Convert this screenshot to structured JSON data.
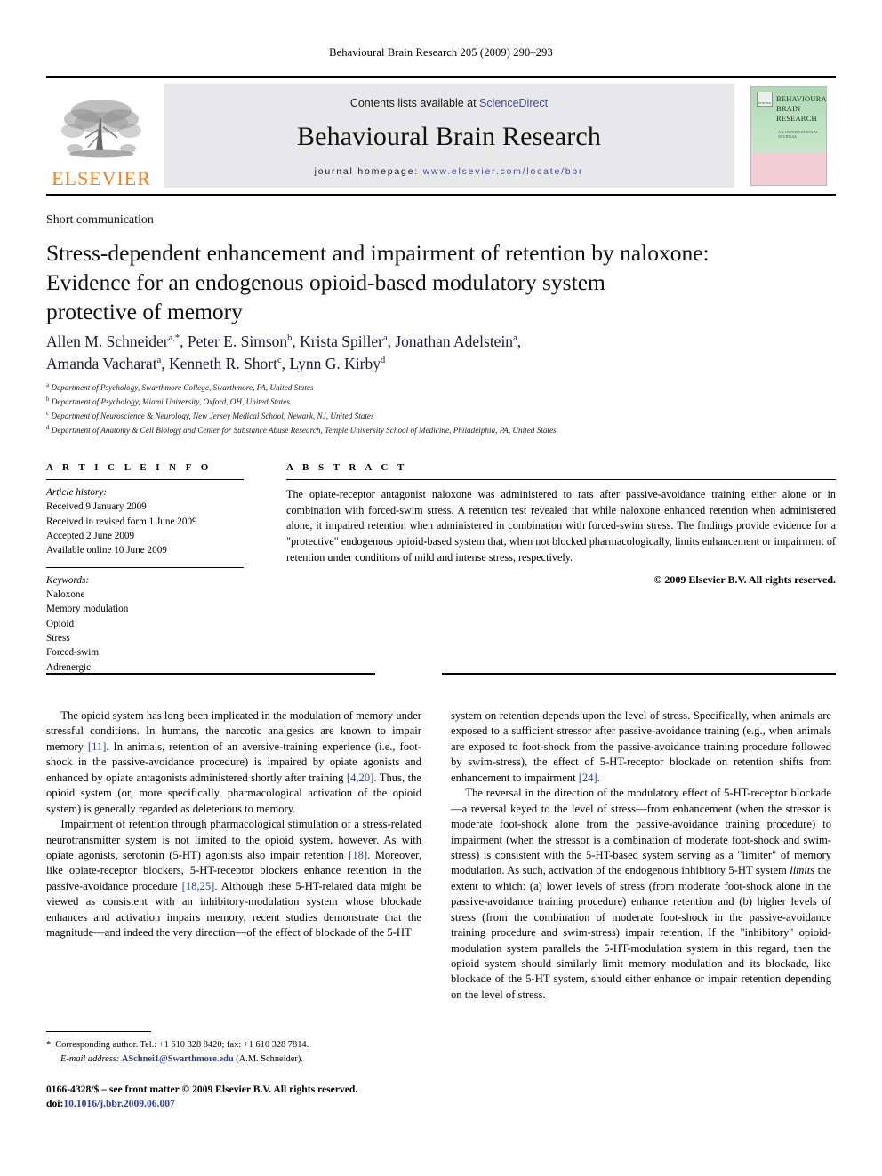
{
  "running_head": "Behavioural Brain Research 205 (2009) 290–293",
  "masthead": {
    "contents_prefix": "Contents lists available at ",
    "sciencedirect": "ScienceDirect",
    "journal_title": "Behavioural Brain Research",
    "homepage_prefix": "journal homepage: ",
    "homepage_url": "www.elsevier.com/locate/bbr",
    "publisher_wordmark": "ELSEVIER",
    "publisher_wordmark_color": "#F08122",
    "cover": {
      "title_line1": "BEHAVIOURAL",
      "title_line2": "BRAIN",
      "title_line3": "RESEARCH",
      "subtitle": "AN INTERNATIONAL JOURNAL",
      "imprint_mark": "ELSEVIER",
      "top_color": "#bfe0c4",
      "bottom_color": "#f3cfd4"
    }
  },
  "article": {
    "type": "Short communication",
    "title_line1": "Stress-dependent enhancement and impairment of retention by naloxone:",
    "title_line2": "Evidence for an endogenous opioid-based modulatory system",
    "title_line3": "protective of memory",
    "authors_line1_a": "Allen M. Schneider",
    "authors_line1_a_sup": "a,*",
    "authors_line1_b": ", Peter E. Simson",
    "authors_line1_b_sup": "b",
    "authors_line1_c": ", Krista Spiller",
    "authors_line1_c_sup": "a",
    "authors_line1_d": ", Jonathan Adelstein",
    "authors_line1_d_sup": "a",
    "authors_line1_end": ",",
    "authors_line2_a": "Amanda Vacharat",
    "authors_line2_a_sup": "a",
    "authors_line2_b": ", Kenneth R. Short",
    "authors_line2_b_sup": "c",
    "authors_line2_c": ", Lynn G. Kirby",
    "authors_line2_c_sup": "d",
    "affiliations": [
      {
        "mark": "a",
        "text": "Department of Psychology, Swarthmore College, Swarthmore, PA, United States"
      },
      {
        "mark": "b",
        "text": "Department of Psychology, Miami University, Oxford, OH, United States"
      },
      {
        "mark": "c",
        "text": "Department of Neuroscience & Neurology, New Jersey Medical School, Newark, NJ, United States"
      },
      {
        "mark": "d",
        "text": "Department of Anatomy & Cell Biology and Center for Substance Abuse Research, Temple University School of Medicine, Philadelphia, PA, United States"
      }
    ]
  },
  "article_info": {
    "heading": "A R T I C L E   I N F O",
    "history_label": "Article history:",
    "history": [
      "Received 9 January 2009",
      "Received in revised form 1 June 2009",
      "Accepted 2 June 2009",
      "Available online 10 June 2009"
    ],
    "keywords_label": "Keywords:",
    "keywords": [
      "Naloxone",
      "Memory modulation",
      "Opioid",
      "Stress",
      "Forced-swim",
      "Adrenergic"
    ]
  },
  "abstract": {
    "heading": "A B S T R A C T",
    "text": "The opiate-receptor antagonist naloxone was administered to rats after passive-avoidance training either alone or in combination with forced-swim stress. A retention test revealed that while naloxone enhanced retention when administered alone, it impaired retention when administered in combination with forced-swim stress. The findings provide evidence for a \"protective\" endogenous opioid-based system that, when not blocked pharmacologically, limits enhancement or impairment of retention under conditions of mild and intense stress, respectively.",
    "copyright": "© 2009 Elsevier B.V. All rights reserved."
  },
  "body": {
    "left": {
      "p1_part1": "The opioid system has long been implicated in the modulation of memory under stressful conditions. In humans, the narcotic analgesics are known to impair memory ",
      "p1_ref1": "[11]",
      "p1_part2": ". In animals, retention of an aversive-training experience (i.e., foot-shock in the passive-avoidance procedure) is impaired by opiate agonists and enhanced by opiate antagonists administered shortly after training ",
      "p1_ref2": "[4,20]",
      "p1_part3": ". Thus, the opioid system (or, more specifically, pharmacological activation of the opioid system) is generally regarded as deleterious to memory.",
      "p2_part1": "Impairment of retention through pharmacological stimulation of a stress-related neurotransmitter system is not limited to the opioid system, however. As with opiate agonists, serotonin (5-HT) agonists also impair retention ",
      "p2_ref1": "[18]",
      "p2_part2": ". Moreover, like opiate-receptor blockers, 5-HT-receptor blockers enhance retention in the passive-avoidance procedure ",
      "p2_ref2": "[18,25]",
      "p2_part3": ". Although these 5-HT-related data might be viewed as consistent with an inhibitory-modulation system whose blockade enhances and activation impairs memory, recent studies demonstrate that the magnitude—and indeed the very direction—of the effect of blockade of the 5-HT"
    },
    "right": {
      "p1_part1": "system on retention depends upon the level of stress. Specifically, when animals are exposed to a sufficient stressor after passive-avoidance training (e.g., when animals are exposed to foot-shock from the passive-avoidance training procedure followed by swim-stress), the effect of 5-HT-receptor blockade on retention shifts from enhancement to impairment ",
      "p1_ref1": "[24]",
      "p1_part2": ".",
      "p2_part1": "The reversal in the direction of the modulatory effect of 5-HT-receptor blockade—a reversal keyed to the level of stress—from enhancement (when the stressor is moderate foot-shock alone from the passive-avoidance training procedure) to impairment (when the stressor is a combination of moderate foot-shock and swim-stress) is consistent with the 5-HT-based system serving as a \"limiter\" of memory modulation. As such, activation of the endogenous inhibitory 5-HT system ",
      "p2_italic": "limits",
      "p2_part2": " the extent to which: (a) lower levels of stress (from moderate foot-shock alone in the passive-avoidance training procedure) enhance retention and (b) higher levels of stress (from the combination of moderate foot-shock in the passive-avoidance training procedure and swim-stress) impair retention. If the \"inhibitory\" opioid-modulation system parallels the 5-HT-modulation system in this regard, then the opioid system should similarly limit memory modulation and its blockade, like blockade of the 5-HT system, should either enhance or impair retention depending on the level of stress."
    }
  },
  "footnote": {
    "star": "*",
    "corresponding": "Corresponding author. Tel.: +1 610 328 8420; fax: +1 610 328 7814.",
    "email_label": "E-mail address:",
    "email": "ASchnei1@Swarthmore.edu",
    "email_attrib": " (A.M. Schneider)."
  },
  "imprint": {
    "line1": "0166-4328/$ – see front matter © 2009 Elsevier B.V. All rights reserved.",
    "doi_label": "doi:",
    "doi": "10.1016/j.bbr.2009.06.007"
  }
}
